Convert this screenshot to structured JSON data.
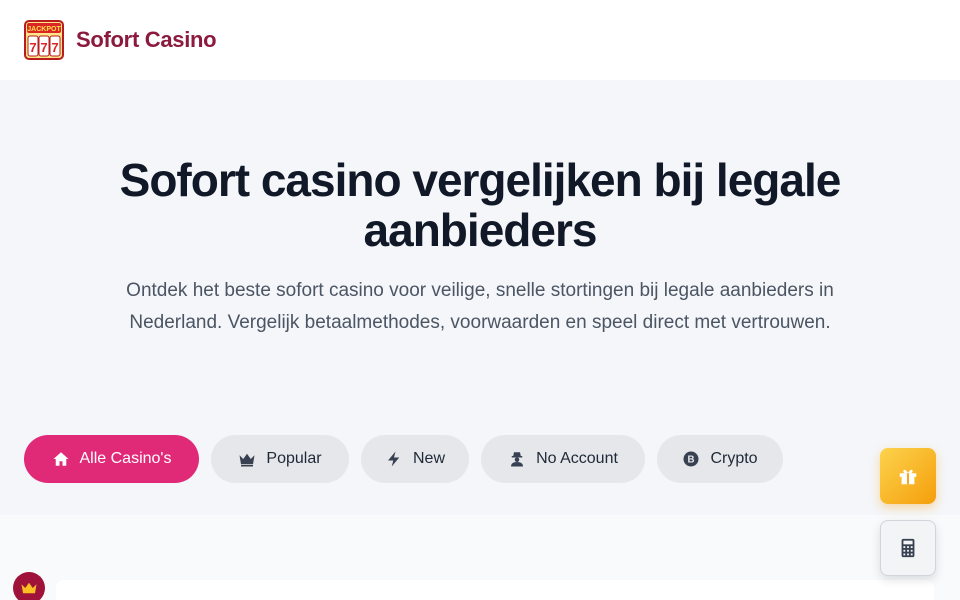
{
  "header": {
    "brand": "Sofort Casino",
    "logo_text": "JACKPOT 777",
    "logo_icon": "slot-machine-icon"
  },
  "hero": {
    "title": "Sofort casino vergelijken bij legale aanbieders",
    "subtitle": "Ontdek het beste sofort casino voor veilige, snelle stortingen bij legale aanbieders in Nederland. Vergelijk betaalmethodes, voorwaarden en speel direct met vertrouwen."
  },
  "filters": [
    {
      "label": "Alle Casino's",
      "icon": "home-icon",
      "active": true
    },
    {
      "label": "Popular",
      "icon": "crown-icon",
      "active": false
    },
    {
      "label": "New",
      "icon": "bolt-icon",
      "active": false
    },
    {
      "label": "No Account",
      "icon": "user-secret-icon",
      "active": false
    },
    {
      "label": "Crypto",
      "icon": "bitcoin-icon",
      "active": false
    }
  ],
  "floating": {
    "gift_icon": "gift-icon",
    "calculator_icon": "calculator-icon",
    "badge_icon": "crown-icon"
  },
  "colors": {
    "brand": "#8b1a3e",
    "accent": "#e02a78",
    "pill_bg": "#e5e7eb",
    "gift_start": "#fcd34d",
    "gift_end": "#f59e0b"
  }
}
